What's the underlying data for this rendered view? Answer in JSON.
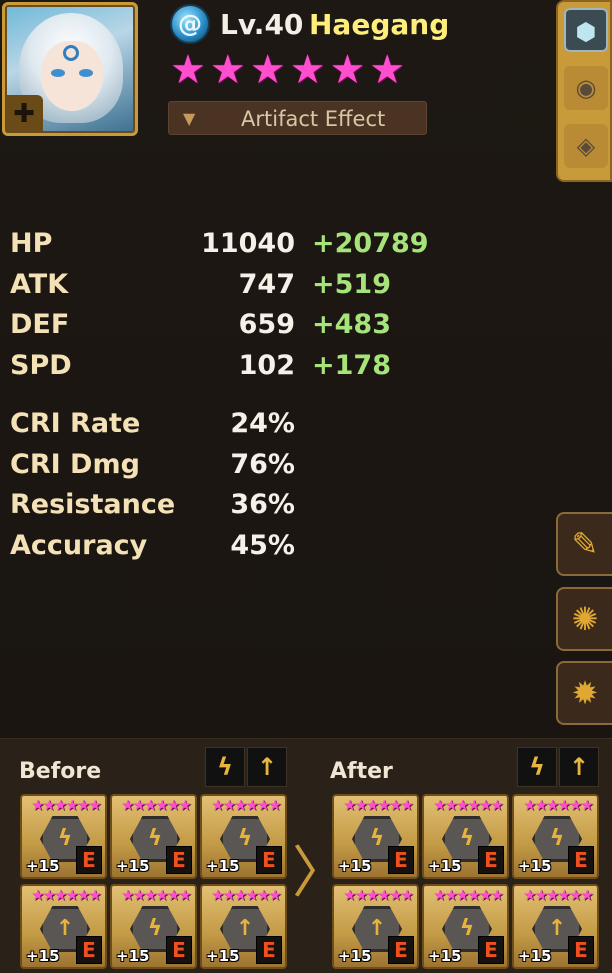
{
  "monster": {
    "element_icon": "wind-swirl-icon",
    "level": "Lv.40",
    "name": "Haegang",
    "stars": [
      "★",
      "★",
      "★",
      "★",
      "★",
      "★"
    ],
    "artifact_label": "Artifact Effect"
  },
  "side_tabs": [
    {
      "icon": "runes-tab-icon"
    },
    {
      "icon": "artifact-tab-icon"
    },
    {
      "icon": "skill-tab-icon"
    }
  ],
  "stats": [
    {
      "label": "HP",
      "base": "11040",
      "bonus": "+20789"
    },
    {
      "label": "ATK",
      "base": "747",
      "bonus": "+519"
    },
    {
      "label": "DEF",
      "base": "659",
      "bonus": "+483"
    },
    {
      "label": "SPD",
      "base": "102",
      "bonus": "+178"
    }
  ],
  "stats2": [
    {
      "label": "CRI Rate",
      "value": "24%"
    },
    {
      "label": "CRI Dmg",
      "value": "76%"
    },
    {
      "label": "Resistance",
      "value": "36%"
    },
    {
      "label": "Accuracy",
      "value": "45%"
    }
  ],
  "actions": [
    {
      "icon": "edit-settings-icon"
    },
    {
      "icon": "rune-equip-icon"
    },
    {
      "icon": "rune-remove-icon"
    }
  ],
  "before": {
    "title": "Before",
    "set_icons": [
      "ϟ",
      "↑"
    ],
    "runes": [
      {
        "stars": "★★★★★★",
        "symbol": "ϟ",
        "level": "+15",
        "grade": "E"
      },
      {
        "stars": "★★★★★★",
        "symbol": "ϟ",
        "level": "+15",
        "grade": "E"
      },
      {
        "stars": "★★★★★★",
        "symbol": "ϟ",
        "level": "+15",
        "grade": "E"
      },
      {
        "stars": "★★★★★★",
        "symbol": "↑",
        "level": "+15",
        "grade": "E"
      },
      {
        "stars": "★★★★★★",
        "symbol": "ϟ",
        "level": "+15",
        "grade": "E"
      },
      {
        "stars": "★★★★★★",
        "symbol": "↑",
        "level": "+15",
        "grade": "E"
      }
    ]
  },
  "after": {
    "title": "After",
    "set_icons": [
      "ϟ",
      "↑"
    ],
    "runes": [
      {
        "stars": "★★★★★★",
        "symbol": "ϟ",
        "level": "+15",
        "grade": "E"
      },
      {
        "stars": "★★★★★★",
        "symbol": "ϟ",
        "level": "+15",
        "grade": "E"
      },
      {
        "stars": "★★★★★★",
        "symbol": "ϟ",
        "level": "+15",
        "grade": "E"
      },
      {
        "stars": "★★★★★★",
        "symbol": "↑",
        "level": "+15",
        "grade": "E"
      },
      {
        "stars": "★★★★★★",
        "symbol": "ϟ",
        "level": "+15",
        "grade": "E"
      },
      {
        "stars": "★★★★★★",
        "symbol": "↑",
        "level": "+15",
        "grade": "E"
      }
    ]
  },
  "compare_arrow": "〉"
}
